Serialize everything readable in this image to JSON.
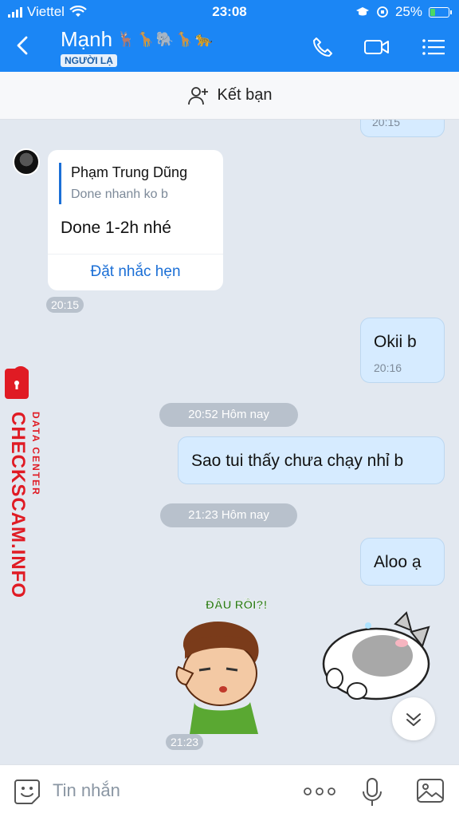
{
  "status": {
    "carrier": "Viettel",
    "time": "23:08",
    "battery": "25%"
  },
  "header": {
    "name": "Mạnh",
    "name_decor": "🦌🦒🐘🦒🐆",
    "badge": "NGƯỜI LẠ"
  },
  "add_friend": {
    "label": "Kết bạn"
  },
  "messages": {
    "partial_time": "20:15",
    "quote": {
      "author": "Phạm Trung Dũng",
      "text": "Done nhanh ko b"
    },
    "reply_text": "Done 1-2h nhé",
    "reminder": "Đặt nhắc hẹn",
    "reply_time": "20:15",
    "okii": {
      "text": "Okii b",
      "time": "20:16"
    },
    "divider1": "20:52 Hôm nay",
    "sao": {
      "text": "Sao tui thấy chưa chạy nhỉ b"
    },
    "divider2": "21:23 Hôm nay",
    "aloo": {
      "text": "Aloo ạ"
    },
    "sticker_caption": "ĐÂU RỒI?!",
    "sticker_time": "21:23"
  },
  "watermark": {
    "text": "CHECKSCAM.INFO",
    "sub": "DATA CENTER"
  },
  "input": {
    "placeholder": "Tin nhắn"
  },
  "colors": {
    "header": "#1b86f5",
    "out_bubble": "#d6ebff",
    "link": "#1b6fd6",
    "watermark": "#e01b24"
  }
}
